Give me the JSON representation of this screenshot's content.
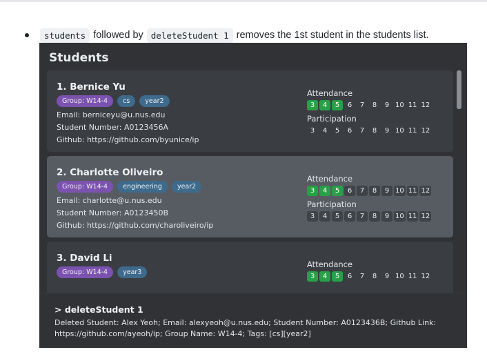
{
  "doc": {
    "code1": "students",
    "text1": "followed by",
    "code2": "deleteStudent 1",
    "text2": "removes the 1st student in the students list."
  },
  "app": {
    "title": "Students",
    "students": [
      {
        "name": "1.  Bernice Yu",
        "tags": [
          "Group: W14-4",
          "cs",
          "year2"
        ],
        "email": "Email: berniceyu@u.nus.edu",
        "number": "Student Number: A0123456A",
        "github": "Github: https://github.com/byunice/ip",
        "attendance_label": "Attendance",
        "participation_label": "Participation"
      },
      {
        "name": "2.  Charlotte Oliveiro",
        "tags": [
          "Group: W14-4",
          "engineering",
          "year2"
        ],
        "email": "Email: charlotte@u.nus.edu",
        "number": "Student Number: A0123450B",
        "github": "Github: https://github.com/charoliveiro/ip",
        "attendance_label": "Attendance",
        "participation_label": "Participation"
      },
      {
        "name": "3.  David Li",
        "tags": [
          "Group: W14-4",
          "year3"
        ],
        "attendance_label": "Attendance"
      }
    ],
    "weeks": [
      "3",
      "4",
      "5",
      "6",
      "7",
      "8",
      "9",
      "10",
      "11",
      "12"
    ],
    "attendance_present_weeks": [
      "3",
      "4",
      "5"
    ],
    "result": {
      "command": ">  deleteStudent 1",
      "message": "Deleted Student: Alex Yeoh; Email: alexyeoh@u.nus.edu; Student Number: A0123436B; Github Link: https://github.com/ayeoh/ip; Group Name: W14-4; Tags: [cs][year2]"
    }
  },
  "colors": {
    "panel_bg": "#303235",
    "card_bg": "#3a3d42",
    "card_selected_bg": "#575c62",
    "group_tag": "#7c52b0",
    "tag": "#3e6a8c",
    "present": "#27a048"
  }
}
